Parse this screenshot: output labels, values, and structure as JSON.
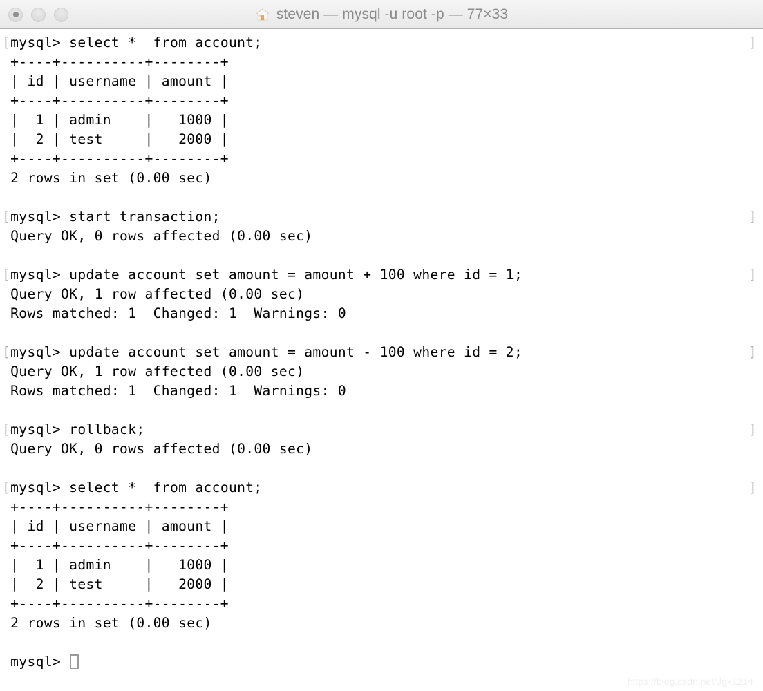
{
  "window": {
    "title": "steven — mysql -u root -p — 77×33",
    "icon": "home-icon",
    "traffic_lights": [
      {
        "name": "close",
        "label": "Close"
      },
      {
        "name": "minimize",
        "label": "Minimize"
      },
      {
        "name": "zoom",
        "label": "Zoom"
      }
    ]
  },
  "terminal": {
    "prompt": "mysql> ",
    "wrap_mark_left": "[",
    "wrap_mark_right": "]",
    "cursor": "block-cursor",
    "lines": [
      {
        "kind": "prompt",
        "text": "[mysql> select *  from account;",
        "mark": true
      },
      {
        "kind": "output",
        "text": " +----+----------+--------+"
      },
      {
        "kind": "output",
        "text": " | id | username | amount |"
      },
      {
        "kind": "output",
        "text": " +----+----------+--------+"
      },
      {
        "kind": "output",
        "text": " |  1 | admin    |   1000 |"
      },
      {
        "kind": "output",
        "text": " |  2 | test     |   2000 |"
      },
      {
        "kind": "output",
        "text": " +----+----------+--------+"
      },
      {
        "kind": "output",
        "text": " 2 rows in set (0.00 sec)"
      },
      {
        "kind": "blank",
        "text": " "
      },
      {
        "kind": "prompt",
        "text": "[mysql> start transaction;",
        "mark": true
      },
      {
        "kind": "output",
        "text": " Query OK, 0 rows affected (0.00 sec)"
      },
      {
        "kind": "blank",
        "text": " "
      },
      {
        "kind": "prompt",
        "text": "[mysql> update account set amount = amount + 100 where id = 1;",
        "mark": true
      },
      {
        "kind": "output",
        "text": " Query OK, 1 row affected (0.00 sec)"
      },
      {
        "kind": "output",
        "text": " Rows matched: 1  Changed: 1  Warnings: 0"
      },
      {
        "kind": "blank",
        "text": " "
      },
      {
        "kind": "prompt",
        "text": "[mysql> update account set amount = amount - 100 where id = 2;",
        "mark": true
      },
      {
        "kind": "output",
        "text": " Query OK, 1 row affected (0.00 sec)"
      },
      {
        "kind": "output",
        "text": " Rows matched: 1  Changed: 1  Warnings: 0"
      },
      {
        "kind": "blank",
        "text": " "
      },
      {
        "kind": "prompt",
        "text": "[mysql> rollback;",
        "mark": true
      },
      {
        "kind": "output",
        "text": " Query OK, 0 rows affected (0.00 sec)"
      },
      {
        "kind": "blank",
        "text": " "
      },
      {
        "kind": "prompt",
        "text": "[mysql> select *  from account;",
        "mark": true
      },
      {
        "kind": "output",
        "text": " +----+----------+--------+"
      },
      {
        "kind": "output",
        "text": " | id | username | amount |"
      },
      {
        "kind": "output",
        "text": " +----+----------+--------+"
      },
      {
        "kind": "output",
        "text": " |  1 | admin    |   1000 |"
      },
      {
        "kind": "output",
        "text": " |  2 | test     |   2000 |"
      },
      {
        "kind": "output",
        "text": " +----+----------+--------+"
      },
      {
        "kind": "output",
        "text": " 2 rows in set (0.00 sec)"
      },
      {
        "kind": "blank",
        "text": " "
      },
      {
        "kind": "input",
        "text": " mysql> "
      }
    ],
    "result_table": {
      "columns": [
        "id",
        "username",
        "amount"
      ],
      "rows": [
        [
          "1",
          "admin",
          "1000"
        ],
        [
          "2",
          "test",
          "2000"
        ]
      ],
      "row_count_text": "2 rows in set (0.00 sec)"
    }
  },
  "watermark": {
    "text": "https://blog.csdn.net/Jgx1214"
  },
  "colors": {
    "background": "#ffffff",
    "text": "#000000",
    "wrap_mark": "#b0b0b0",
    "titlebar": "#eeeeee",
    "title_text": "#8b8b8b",
    "cursor_outline": "#9a9a9a",
    "watermark": "#f0f0f0"
  }
}
